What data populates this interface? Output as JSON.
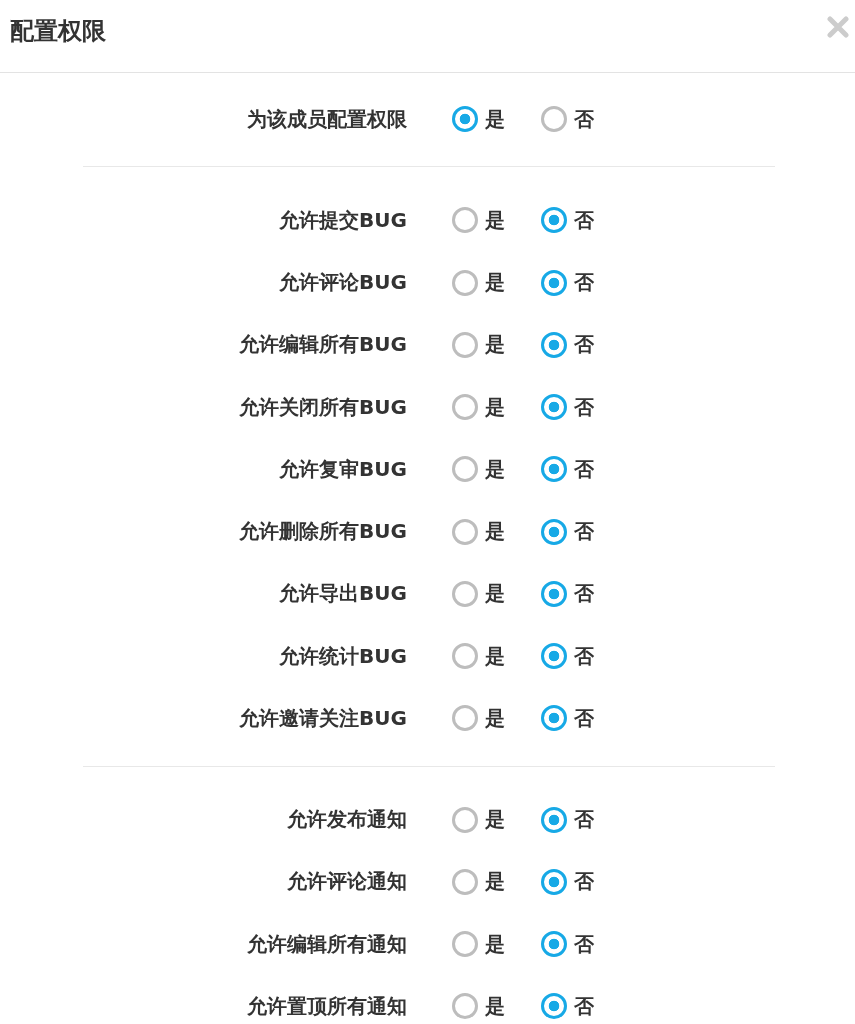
{
  "dialog": {
    "title": "配置权限"
  },
  "sections": [
    {
      "rows": [
        {
          "label": "为该成员配置权限",
          "options": [
            {
              "label": "是",
              "selected": true
            },
            {
              "label": "否",
              "selected": false
            }
          ]
        }
      ]
    },
    {
      "rows": [
        {
          "label": "允许提交BUG",
          "options": [
            {
              "label": "是",
              "selected": false
            },
            {
              "label": "否",
              "selected": true
            }
          ]
        },
        {
          "label": "允许评论BUG",
          "options": [
            {
              "label": "是",
              "selected": false
            },
            {
              "label": "否",
              "selected": true
            }
          ]
        },
        {
          "label": "允许编辑所有BUG",
          "options": [
            {
              "label": "是",
              "selected": false
            },
            {
              "label": "否",
              "selected": true
            }
          ]
        },
        {
          "label": "允许关闭所有BUG",
          "options": [
            {
              "label": "是",
              "selected": false
            },
            {
              "label": "否",
              "selected": true
            }
          ]
        },
        {
          "label": "允许复审BUG",
          "options": [
            {
              "label": "是",
              "selected": false
            },
            {
              "label": "否",
              "selected": true
            }
          ]
        },
        {
          "label": "允许删除所有BUG",
          "options": [
            {
              "label": "是",
              "selected": false
            },
            {
              "label": "否",
              "selected": true
            }
          ]
        },
        {
          "label": "允许导出BUG",
          "options": [
            {
              "label": "是",
              "selected": false
            },
            {
              "label": "否",
              "selected": true
            }
          ]
        },
        {
          "label": "允许统计BUG",
          "options": [
            {
              "label": "是",
              "selected": false
            },
            {
              "label": "否",
              "selected": true
            }
          ]
        },
        {
          "label": "允许邀请关注BUG",
          "options": [
            {
              "label": "是",
              "selected": false
            },
            {
              "label": "否",
              "selected": true
            }
          ]
        }
      ]
    },
    {
      "rows": [
        {
          "label": "允许发布通知",
          "options": [
            {
              "label": "是",
              "selected": false
            },
            {
              "label": "否",
              "selected": true
            }
          ]
        },
        {
          "label": "允许评论通知",
          "options": [
            {
              "label": "是",
              "selected": false
            },
            {
              "label": "否",
              "selected": true
            }
          ]
        },
        {
          "label": "允许编辑所有通知",
          "options": [
            {
              "label": "是",
              "selected": false
            },
            {
              "label": "否",
              "selected": true
            }
          ]
        },
        {
          "label": "允许置顶所有通知",
          "options": [
            {
              "label": "是",
              "selected": false
            },
            {
              "label": "否",
              "selected": true
            }
          ]
        }
      ]
    }
  ]
}
